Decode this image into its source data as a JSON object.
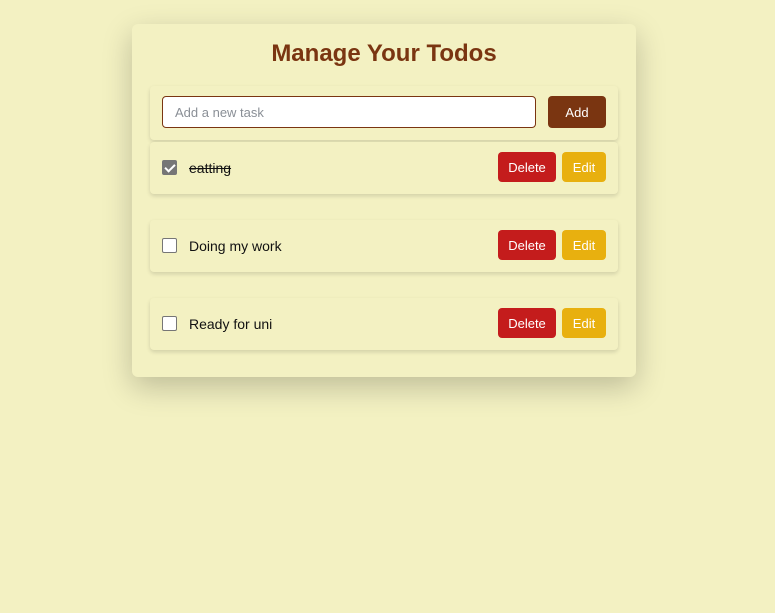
{
  "header": {
    "title": "Manage Your Todos"
  },
  "form": {
    "input_placeholder": "Add a new task",
    "input_value": "",
    "add_label": "Add"
  },
  "todos": [
    {
      "text": "eatting",
      "completed": true,
      "delete_label": "Delete",
      "edit_label": "Edit"
    },
    {
      "text": "Doing my work",
      "completed": false,
      "delete_label": "Delete",
      "edit_label": "Edit"
    },
    {
      "text": "Ready for uni",
      "completed": false,
      "delete_label": "Delete",
      "edit_label": "Edit"
    }
  ],
  "colors": {
    "background": "#f3f1c2",
    "brand": "#7a3511",
    "delete": "#c41c1c",
    "edit": "#e8b00f",
    "checkbox_checked": "#767676"
  }
}
